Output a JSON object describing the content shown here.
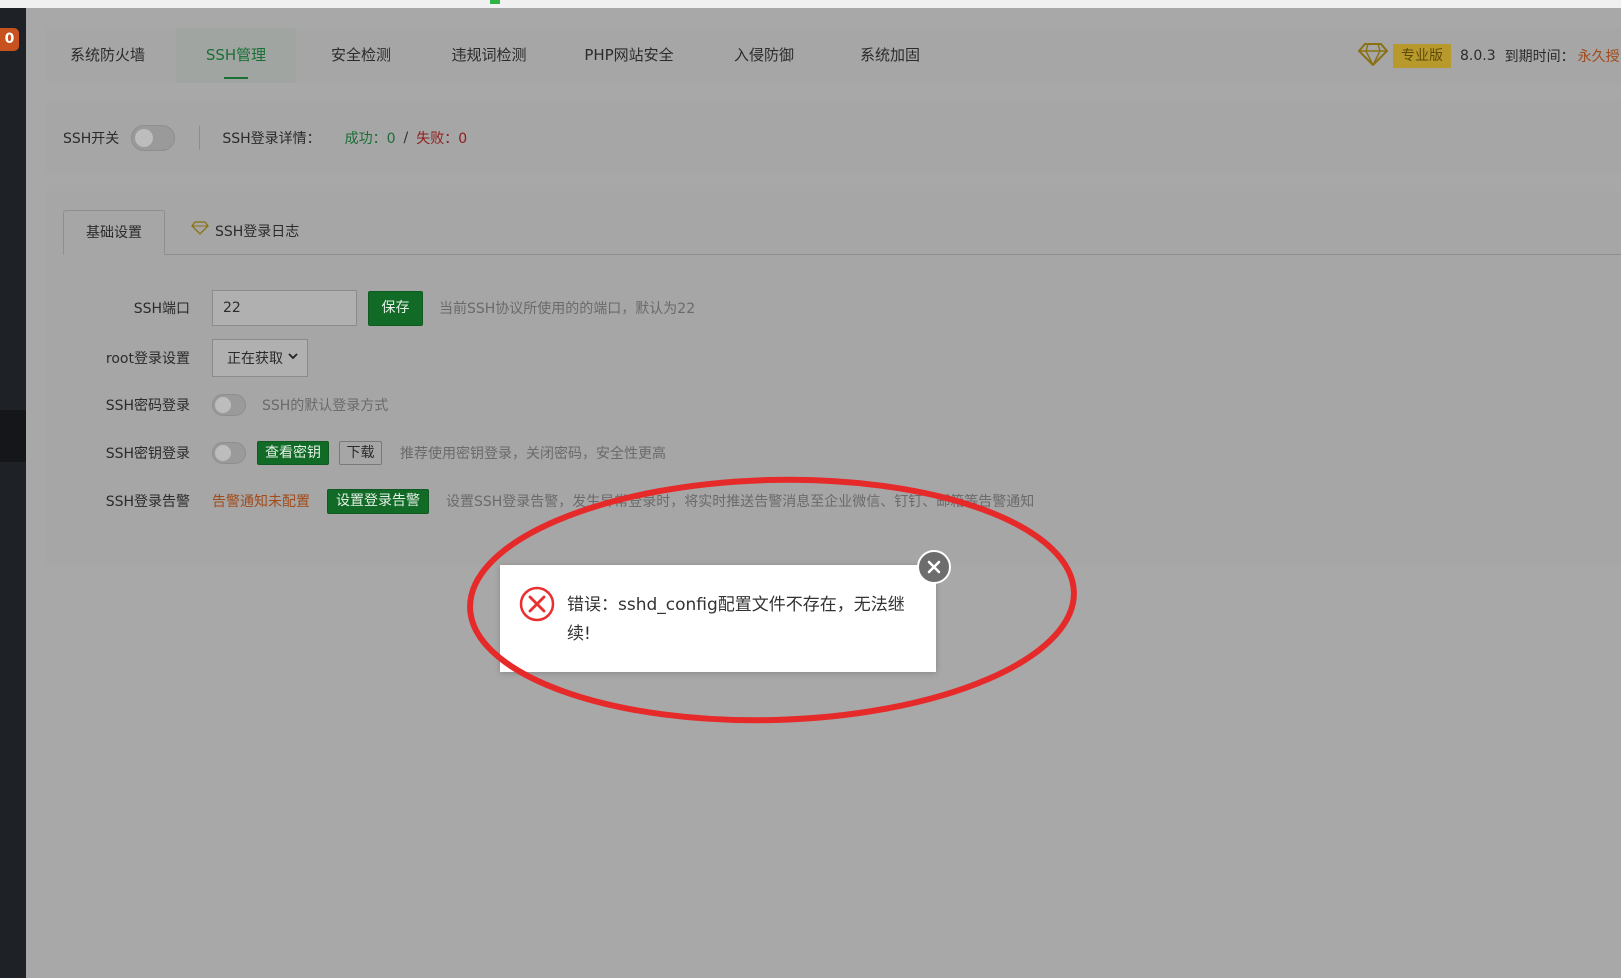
{
  "sidebar": {
    "badge": "0"
  },
  "nav": {
    "tabs": [
      {
        "label": "系统防火墙"
      },
      {
        "label": "SSH管理"
      },
      {
        "label": "安全检测"
      },
      {
        "label": "违规词检测"
      },
      {
        "label": "PHP网站安全"
      },
      {
        "label": "入侵防御"
      },
      {
        "label": "系统加固"
      }
    ],
    "pro_label": "专业版",
    "version": "8.0.3",
    "expire_label": "到期时间：",
    "expire_value": "永久授"
  },
  "status": {
    "ssh_switch_label": "SSH开关",
    "login_detail_label": "SSH登录详情：",
    "success_text": "成功：0",
    "slash": "/",
    "fail_text": "失败：0"
  },
  "subtabs": {
    "basic": "基础设置",
    "log": "SSH登录日志"
  },
  "form": {
    "port_label": "SSH端口",
    "port_value": "22",
    "save_button": "保存",
    "port_hint": "当前SSH协议所使用的的端口，默认为22",
    "root_label": "root登录设置",
    "root_value": "正在获取",
    "password_label": "SSH密码登录",
    "password_hint": "SSH的默认登录方式",
    "key_label": "SSH密钥登录",
    "view_key_button": "查看密钥",
    "download_button": "下载",
    "key_hint": "推荐使用密钥登录，关闭密码，安全性更高",
    "alarm_label": "SSH登录告警",
    "alarm_status": "告警通知未配置",
    "alarm_button": "设置登录告警",
    "alarm_hint": "设置SSH登录告警，发生异常登录时，将实时推送告警消息至企业微信、钉钉、邮箱等告警通知"
  },
  "dialog": {
    "message": "错误：sshd_config配置文件不存在，无法继续!"
  },
  "colors": {
    "accent_green": "#20a53a",
    "error_red": "#e8312f",
    "annotation_red": "#e62a2a",
    "pro_gold": "#e6c042"
  }
}
